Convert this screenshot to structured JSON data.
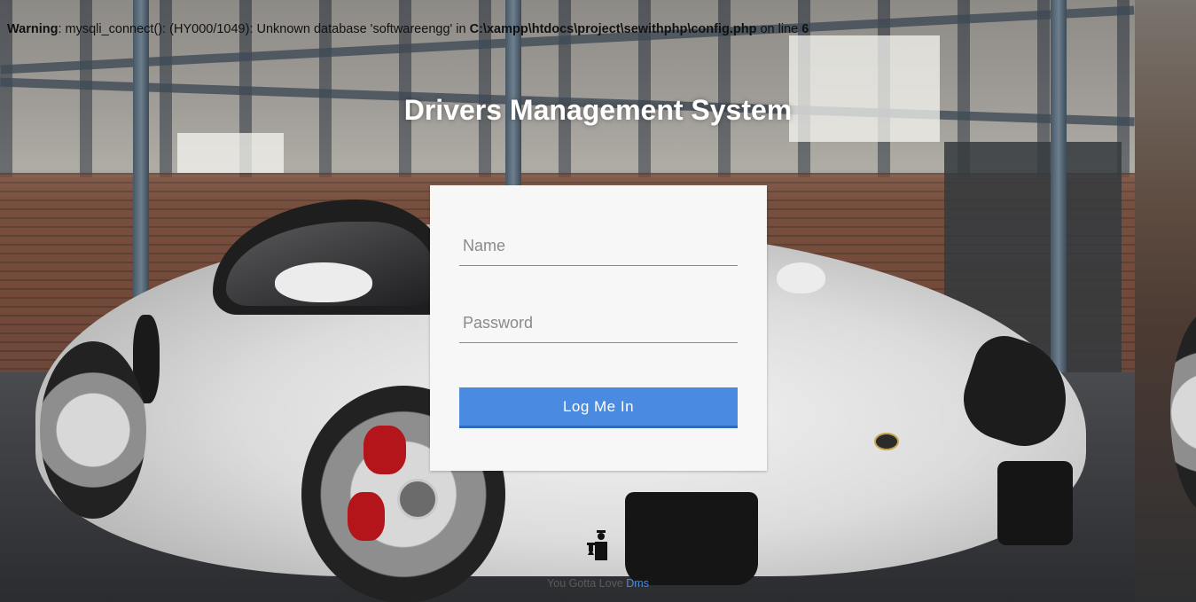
{
  "warning": {
    "label": "Warning",
    "message": ": mysqli_connect(): (HY000/1049): Unknown database 'softwareengg' in ",
    "path": "C:\\xampp\\htdocs\\project\\sewithphp\\config.php",
    "line_text": " on line ",
    "line_number": "6"
  },
  "title": "Drivers Management System",
  "login": {
    "name_placeholder": "Name",
    "password_placeholder": "Password",
    "submit_label": "Log Me In"
  },
  "footer": {
    "icon": "driver-icon",
    "text": "You Gotta Love ",
    "link": "Dms"
  },
  "colors": {
    "button": "#4a8ae0",
    "card": "#f7f7f7",
    "title": "#ffffff"
  }
}
